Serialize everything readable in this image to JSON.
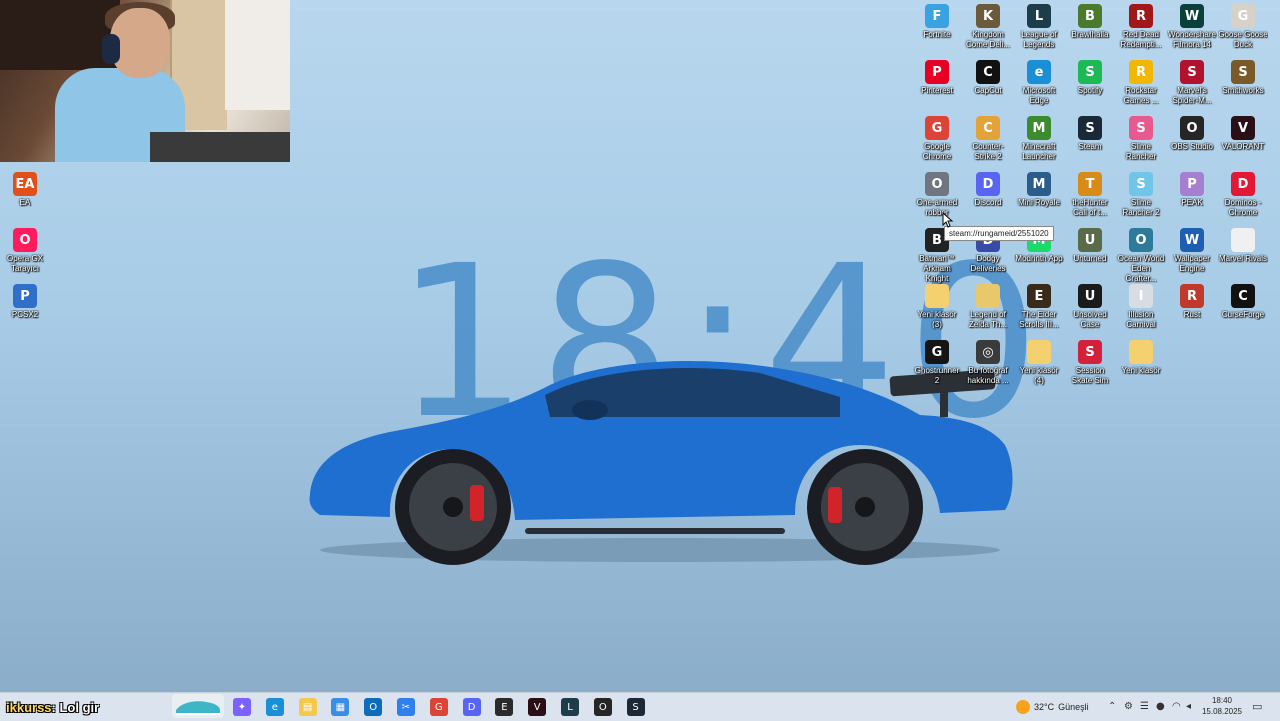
{
  "desktop": {
    "clock_text": "18:40",
    "left_icons": [
      {
        "label": "EA",
        "icon": "ea-icon",
        "color": "#e0501b",
        "glyph": "EA"
      },
      {
        "label": "Opera GX Tarayıcı",
        "icon": "opera-gx-icon",
        "color": "#ff1b5c",
        "glyph": "O"
      },
      {
        "label": "PCSX2",
        "icon": "pcsx2-icon",
        "color": "#2f6fc9",
        "glyph": "P"
      }
    ],
    "grid_icons": [
      {
        "label": "Fortnite",
        "icon": "fortnite-icon",
        "color": "#3aa2e0",
        "glyph": "F"
      },
      {
        "label": "Kingdom Come Deli...",
        "icon": "kingdom-come-icon",
        "color": "#6b5a3c",
        "glyph": "K"
      },
      {
        "label": "League of Legends",
        "icon": "league-of-legends-icon",
        "color": "#1e3d4a",
        "glyph": "L"
      },
      {
        "label": "Brawlhalla",
        "icon": "brawlhalla-icon",
        "color": "#4b7a2c",
        "glyph": "B"
      },
      {
        "label": "Red Dead Redempti...",
        "icon": "red-dead-icon",
        "color": "#a01818",
        "glyph": "R"
      },
      {
        "label": "Wondershare Filmora 14",
        "icon": "filmora-icon",
        "color": "#0b3f3a",
        "glyph": "W"
      },
      {
        "label": "Goose Goose Duck",
        "icon": "goose-goose-duck-icon",
        "color": "#d7d2c9",
        "glyph": "G"
      },
      {
        "label": "Pinterest",
        "icon": "pinterest-icon",
        "color": "#e60023",
        "glyph": "P"
      },
      {
        "label": "CapCut",
        "icon": "capcut-icon",
        "color": "#111111",
        "glyph": "C"
      },
      {
        "label": "Microsoft Edge",
        "icon": "edge-icon",
        "color": "#1b8fd6",
        "glyph": "e"
      },
      {
        "label": "Spotify",
        "icon": "spotify-icon",
        "color": "#1db954",
        "glyph": "S"
      },
      {
        "label": "Rockstar Games ...",
        "icon": "rockstar-icon",
        "color": "#f2b705",
        "glyph": "R"
      },
      {
        "label": "Marvel's Spider-M...",
        "icon": "spiderman-icon",
        "color": "#b3122e",
        "glyph": "S"
      },
      {
        "label": "Smithworks",
        "icon": "smithworks-icon",
        "color": "#7b5a2a",
        "glyph": "S"
      },
      {
        "label": "Google Chrome",
        "icon": "chrome-icon",
        "color": "#db4437",
        "glyph": "G"
      },
      {
        "label": "Counter-Strike 2",
        "icon": "counter-strike-icon",
        "color": "#e3a33a",
        "glyph": "C"
      },
      {
        "label": "Minecraft Launcher",
        "icon": "minecraft-icon",
        "color": "#3c8b2f",
        "glyph": "M"
      },
      {
        "label": "Steam",
        "icon": "steam-icon",
        "color": "#1b2838",
        "glyph": "S"
      },
      {
        "label": "Slime Rancher",
        "icon": "slime-rancher-icon",
        "color": "#e85a8f",
        "glyph": "S"
      },
      {
        "label": "OBS Studio",
        "icon": "obs-icon",
        "color": "#262626",
        "glyph": "O"
      },
      {
        "label": "VALORANT",
        "icon": "valorant-icon",
        "color": "#2b0f16",
        "glyph": "V"
      },
      {
        "label": "One-armed robber",
        "icon": "one-armed-robber-icon",
        "color": "#6f7680",
        "glyph": "O"
      },
      {
        "label": "Discord",
        "icon": "discord-icon",
        "color": "#5865f2",
        "glyph": "D"
      },
      {
        "label": "Mini Royale",
        "icon": "mini-royale-icon",
        "color": "#2a5d8c",
        "glyph": "M"
      },
      {
        "label": "theHunter Call of t...",
        "icon": "thehunter-icon",
        "color": "#d98b1a",
        "glyph": "T"
      },
      {
        "label": "Slime Rancher 2",
        "icon": "slime-rancher-2-icon",
        "color": "#6fc6e8",
        "glyph": "S"
      },
      {
        "label": "PEAK",
        "icon": "peak-icon",
        "color": "#a77fd1",
        "glyph": "P"
      },
      {
        "label": "Dominos - Chrome",
        "icon": "dominos-icon",
        "color": "#e31837",
        "glyph": "D"
      },
      {
        "label": "Batman™ Arkham Knight",
        "icon": "batman-icon",
        "color": "#222222",
        "glyph": "B"
      },
      {
        "label": "Dodgy Deliveries",
        "icon": "dodgy-deliveries-icon",
        "color": "#3a4aa8",
        "glyph": "D"
      },
      {
        "label": "Modrinth App",
        "icon": "modrinth-icon",
        "color": "#1bd96a",
        "glyph": "M"
      },
      {
        "label": "Unturned",
        "icon": "unturned-icon",
        "color": "#5a6b4a",
        "glyph": "U"
      },
      {
        "label": "Ocean World Eden Crafter...",
        "icon": "ocean-world-icon",
        "color": "#2e7a9a",
        "glyph": "O"
      },
      {
        "label": "Wallpaper Engine",
        "icon": "wallpaper-engine-icon",
        "color": "#1f5fb0",
        "glyph": "W"
      },
      {
        "label": "Marvel Rivals",
        "icon": "marvel-rivals-icon",
        "color": "#f0f0f0",
        "glyph": ""
      },
      {
        "label": "Yeni klasör (3)",
        "icon": "folder-icon",
        "color": "#f4d06f",
        "glyph": ""
      },
      {
        "label": "Legend of Zelda Th...",
        "icon": "zelda-icon",
        "color": "#e8c86a",
        "glyph": ""
      },
      {
        "label": "The Elder Scrolls III...",
        "icon": "elder-scrolls-icon",
        "color": "#3a2a1a",
        "glyph": "E"
      },
      {
        "label": "Unsolved Case",
        "icon": "unsolved-case-icon",
        "color": "#1a1a1a",
        "glyph": "U"
      },
      {
        "label": "Illusion Carnival",
        "icon": "illusion-carnival-icon",
        "color": "#d8dde3",
        "glyph": "I"
      },
      {
        "label": "Rust",
        "icon": "rust-icon",
        "color": "#c0392b",
        "glyph": "R"
      },
      {
        "label": "CurseForge",
        "icon": "curseforge-icon",
        "color": "#111111",
        "glyph": "C"
      },
      {
        "label": "Ghostrunner 2",
        "icon": "ghostrunner-icon",
        "color": "#151515",
        "glyph": "G"
      },
      {
        "label": "Bu fotoğraf hakkında ...",
        "icon": "photo-info-icon",
        "color": "#3b3b3b",
        "glyph": "◎"
      },
      {
        "label": "Yeni klasör (4)",
        "icon": "folder-icon",
        "color": "#f4d06f",
        "glyph": ""
      },
      {
        "label": "Session Skate Sim",
        "icon": "session-icon",
        "color": "#d4213b",
        "glyph": "S"
      },
      {
        "label": "Yeni klasör",
        "icon": "folder-icon",
        "color": "#f4d06f",
        "glyph": ""
      }
    ],
    "tooltip": "steam://rungameid/2551020"
  },
  "overlay": {
    "name": "ikkurss",
    "text": ": Lol gir"
  },
  "taskbar": {
    "apps": [
      {
        "name": "copilot-icon",
        "color": "#7b61ff",
        "glyph": "✦"
      },
      {
        "name": "edge-taskbar-icon",
        "color": "#1b8fd6",
        "glyph": "e"
      },
      {
        "name": "file-explorer-icon",
        "color": "#f2c94c",
        "glyph": "▤"
      },
      {
        "name": "store-icon",
        "color": "#3a8ee6",
        "glyph": "▦"
      },
      {
        "name": "outlook-icon",
        "color": "#0f6cbd",
        "glyph": "O"
      },
      {
        "name": "snipping-tool-icon",
        "color": "#2f80ed",
        "glyph": "✂"
      },
      {
        "name": "chrome-taskbar-icon",
        "color": "#db4437",
        "glyph": "G"
      },
      {
        "name": "discord-taskbar-icon",
        "color": "#5865f2",
        "glyph": "D"
      },
      {
        "name": "epic-games-icon",
        "color": "#2a2a2a",
        "glyph": "E"
      },
      {
        "name": "valorant-taskbar-icon",
        "color": "#2b0f16",
        "glyph": "V"
      },
      {
        "name": "league-taskbar-icon",
        "color": "#1e3d4a",
        "glyph": "L"
      },
      {
        "name": "obs-taskbar-icon",
        "color": "#262626",
        "glyph": "O"
      },
      {
        "name": "steam-taskbar-icon",
        "color": "#1b2838",
        "glyph": "S"
      }
    ],
    "weather": {
      "temp": "32°C",
      "condition": "Güneşli"
    },
    "time": "18:40",
    "date": "15.08.2025"
  }
}
